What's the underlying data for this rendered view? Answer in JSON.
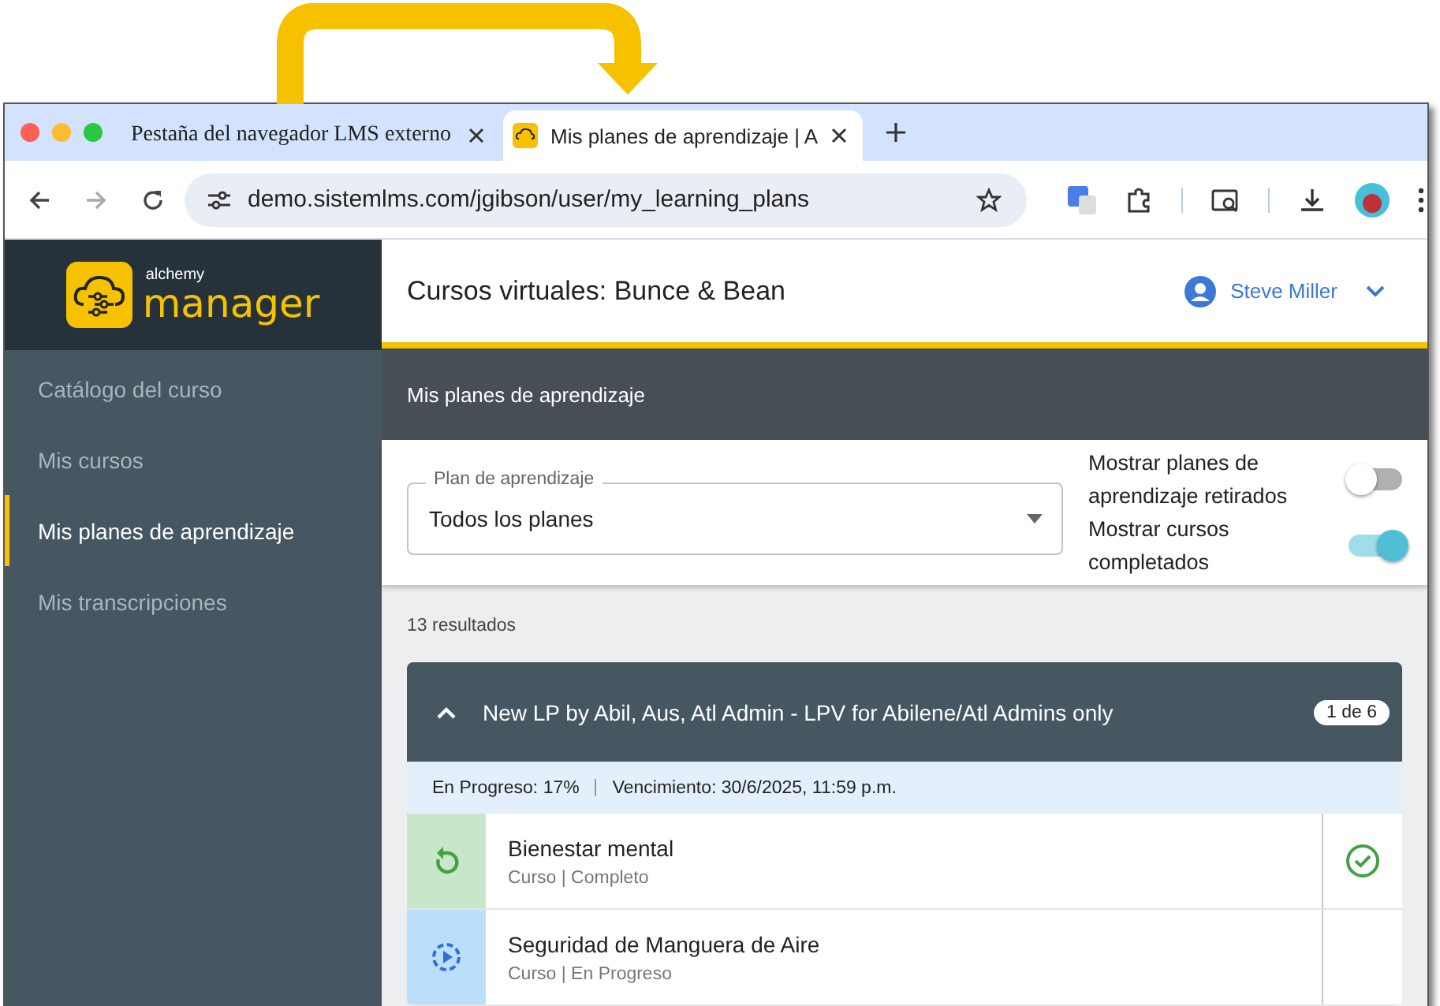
{
  "browser": {
    "tabs": [
      {
        "title": "Pestaña del navegador LMS externo",
        "selected": false,
        "kind": "plain"
      },
      {
        "title": "Mis planes de aprendizaje | A",
        "selected": true,
        "kind": "app"
      }
    ],
    "url": "demo.sistemlms.com/jgibson/user/my_learning_plans"
  },
  "sidebar": {
    "logo_small": "alchemy",
    "logo_large": "manager",
    "items": [
      {
        "label": "Catálogo del curso",
        "selected": false
      },
      {
        "label": "Mis cursos",
        "selected": false
      },
      {
        "label": "Mis planes de aprendizaje",
        "selected": true
      },
      {
        "label": "Mis transcripciones",
        "selected": false
      }
    ]
  },
  "header": {
    "title": "Cursos virtuales: Bunce & Bean",
    "user": "Steve Miller"
  },
  "section_title": "Mis planes de aprendizaje",
  "filter": {
    "label": "Plan de aprendizaje",
    "value": "Todos los planes"
  },
  "toggles": [
    {
      "label": "Mostrar planes de aprendizaje retirados",
      "on": false
    },
    {
      "label": "Mostrar cursos completados",
      "on": true
    }
  ],
  "results": "13 resultados",
  "plan": {
    "title": "New LP by Abil, Aus, Atl Admin - LPV for Abilene/Atl Admins only",
    "expanded": true,
    "badge": "1 de 6",
    "progress": "En Progreso: 17%",
    "due": "Vencimiento: 30/6/2025, 11:59 p.m.",
    "items": [
      {
        "title": "Bienestar mental",
        "subtitle": "Curso | Completo",
        "kind": "complete"
      },
      {
        "title": "Seguridad de Manguera de Aire",
        "subtitle": "Curso | En Progreso",
        "kind": "in_progress"
      }
    ]
  }
}
